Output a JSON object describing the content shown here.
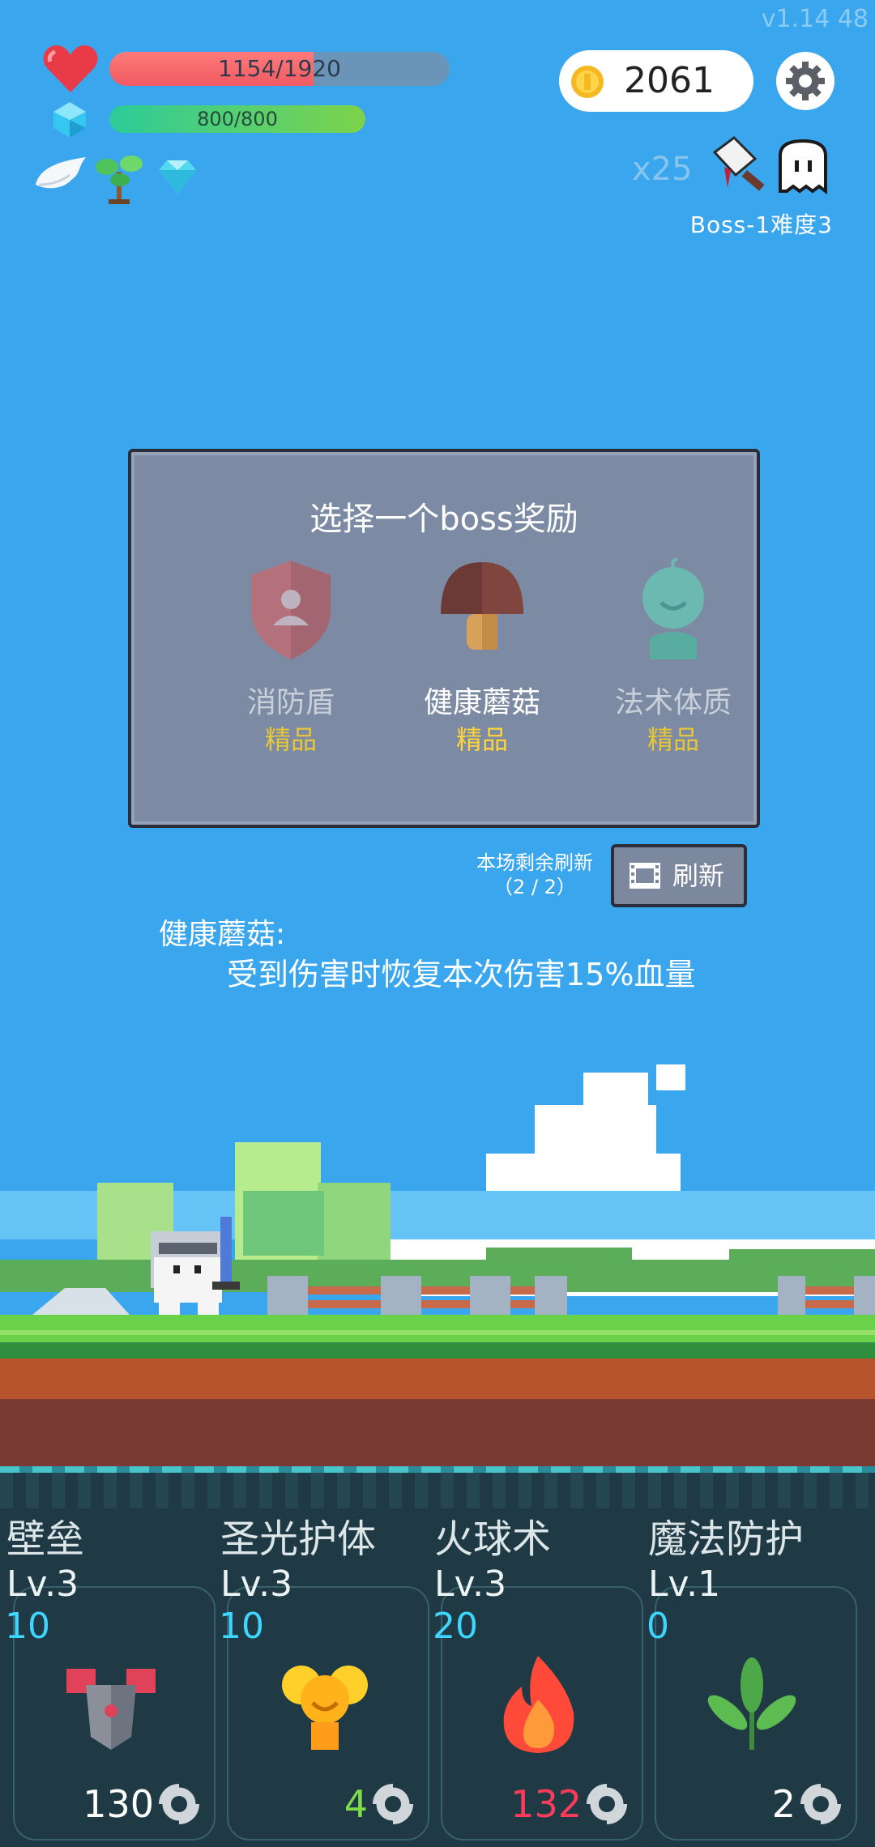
{
  "version": "v1.14   48",
  "hud": {
    "hp": {
      "text": "1154/1920",
      "fraction": 0.601
    },
    "mp": {
      "text": "800/800",
      "fraction": 1.0
    },
    "buffs": [
      "wing-icon",
      "sapling-icon",
      "diamond-icon"
    ],
    "coins": "2061",
    "multiplier": "x25",
    "boss_label": "Boss-1难度3"
  },
  "dialog": {
    "title": "选择一个boss奖励",
    "rewards": [
      {
        "name": "消防盾",
        "rarity": "精品",
        "icon": "shield-icon",
        "selected": false
      },
      {
        "name": "健康蘑菇",
        "rarity": "精品",
        "icon": "mushroom-icon",
        "selected": true
      },
      {
        "name": "法术体质",
        "rarity": "精品",
        "icon": "spirit-icon",
        "selected": false
      }
    ]
  },
  "refresh": {
    "info_line1": "本场剩余刷新",
    "info_line2": "（2 / 2）",
    "button_label": "刷新"
  },
  "description": {
    "title": "健康蘑菇:",
    "body": "受到伤害时恢复本次伤害15%血量"
  },
  "skills": [
    {
      "name": "壁垒",
      "level": "Lv.3",
      "count": "10",
      "cost": "130",
      "cost_color": "#ffffff",
      "icon": "armor-icon"
    },
    {
      "name": "圣光护体",
      "level": "Lv.3",
      "count": "10",
      "cost": "4",
      "cost_color": "#7dde4a",
      "icon": "holy-light-icon"
    },
    {
      "name": "火球术",
      "level": "Lv.3",
      "count": "20",
      "cost": "132",
      "cost_color": "#ff3b5c",
      "icon": "fireball-icon"
    },
    {
      "name": "魔法防护",
      "level": "Lv.1",
      "count": "0",
      "cost": "2",
      "cost_color": "#ffffff",
      "icon": "leaf-icon"
    }
  ]
}
